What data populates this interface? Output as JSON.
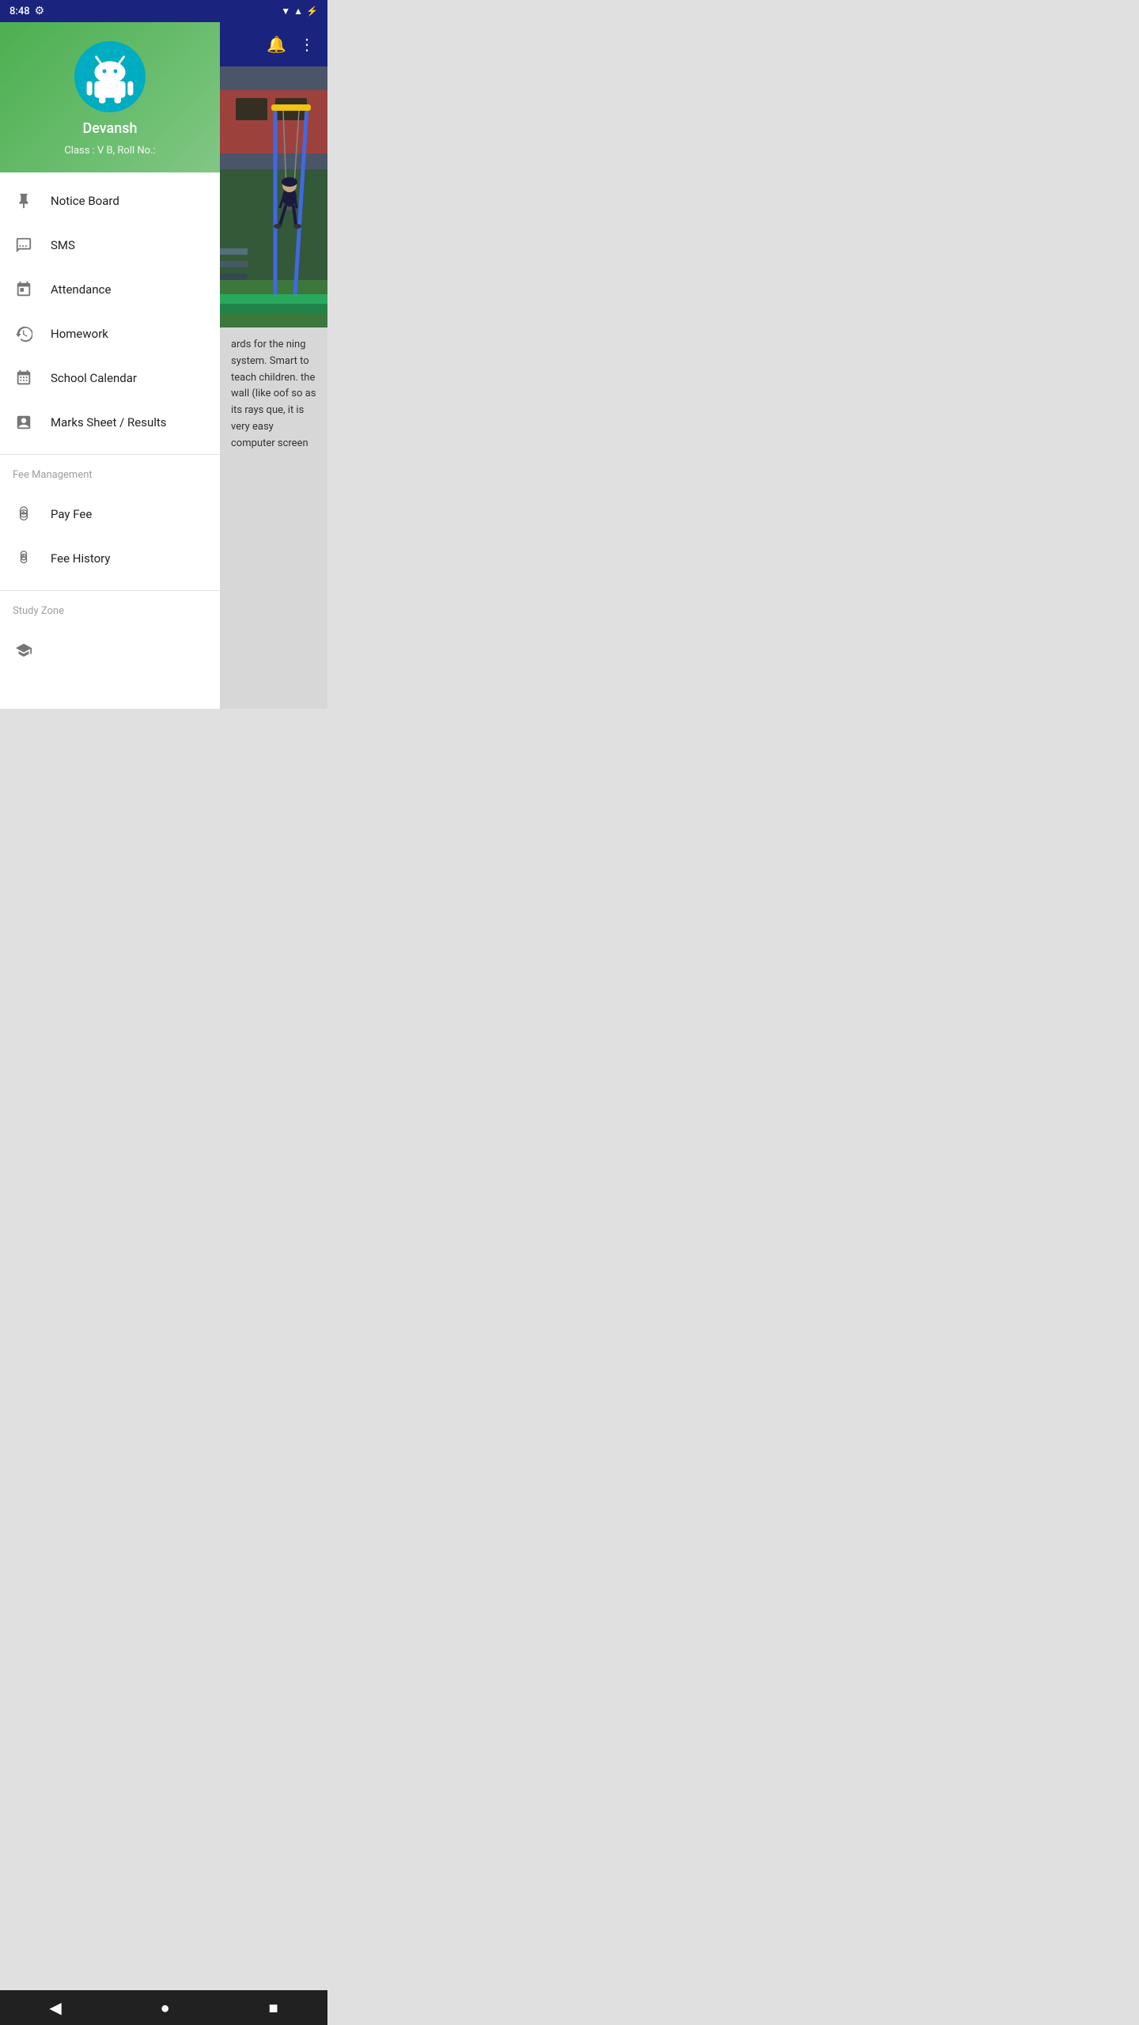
{
  "statusBar": {
    "time": "8:48",
    "leftIcons": [
      "gear"
    ],
    "rightIcons": [
      "wifi",
      "signal",
      "battery"
    ]
  },
  "drawer": {
    "user": {
      "name": "Devansh",
      "classInfo": "Class : V B,  Roll No.:"
    },
    "menuItems": [
      {
        "id": "notice-board",
        "label": "Notice Board",
        "icon": "pin"
      },
      {
        "id": "sms",
        "label": "SMS",
        "icon": "message"
      },
      {
        "id": "attendance",
        "label": "Attendance",
        "icon": "calendar-check"
      },
      {
        "id": "homework",
        "label": "Homework",
        "icon": "homework"
      },
      {
        "id": "school-calendar",
        "label": "School Calendar",
        "icon": "calendar-grid"
      },
      {
        "id": "marks-sheet",
        "label": "Marks Sheet / Results",
        "icon": "marks"
      }
    ],
    "sections": [
      {
        "id": "fee-management",
        "header": "Fee Management",
        "items": [
          {
            "id": "pay-fee",
            "label": "Pay Fee",
            "icon": "coins-rupee"
          },
          {
            "id": "fee-history",
            "label": "Fee History",
            "icon": "coins-rupee2"
          }
        ]
      },
      {
        "id": "study-zone",
        "header": "Study Zone",
        "items": []
      }
    ]
  },
  "toolbar": {
    "notificationIcon": "bell",
    "moreIcon": "more-vertical"
  },
  "contentText": "ards for the ning system. Smart  to teach children. the wall (like oof so as its rays que, it is very easy computer screen"
}
